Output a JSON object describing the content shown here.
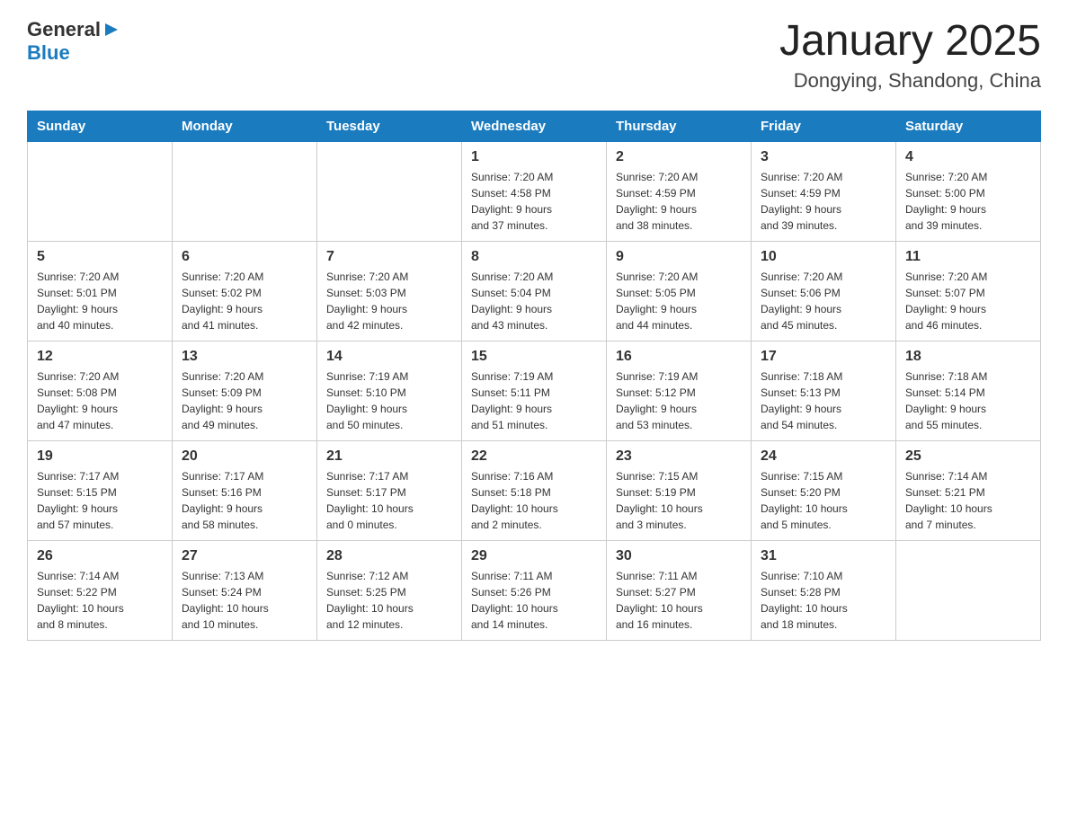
{
  "header": {
    "logo_general": "General",
    "logo_blue": "Blue",
    "month_title": "January 2025",
    "location": "Dongying, Shandong, China"
  },
  "days_of_week": [
    "Sunday",
    "Monday",
    "Tuesday",
    "Wednesday",
    "Thursday",
    "Friday",
    "Saturday"
  ],
  "weeks": [
    [
      {
        "day": "",
        "info": ""
      },
      {
        "day": "",
        "info": ""
      },
      {
        "day": "",
        "info": ""
      },
      {
        "day": "1",
        "info": "Sunrise: 7:20 AM\nSunset: 4:58 PM\nDaylight: 9 hours\nand 37 minutes."
      },
      {
        "day": "2",
        "info": "Sunrise: 7:20 AM\nSunset: 4:59 PM\nDaylight: 9 hours\nand 38 minutes."
      },
      {
        "day": "3",
        "info": "Sunrise: 7:20 AM\nSunset: 4:59 PM\nDaylight: 9 hours\nand 39 minutes."
      },
      {
        "day": "4",
        "info": "Sunrise: 7:20 AM\nSunset: 5:00 PM\nDaylight: 9 hours\nand 39 minutes."
      }
    ],
    [
      {
        "day": "5",
        "info": "Sunrise: 7:20 AM\nSunset: 5:01 PM\nDaylight: 9 hours\nand 40 minutes."
      },
      {
        "day": "6",
        "info": "Sunrise: 7:20 AM\nSunset: 5:02 PM\nDaylight: 9 hours\nand 41 minutes."
      },
      {
        "day": "7",
        "info": "Sunrise: 7:20 AM\nSunset: 5:03 PM\nDaylight: 9 hours\nand 42 minutes."
      },
      {
        "day": "8",
        "info": "Sunrise: 7:20 AM\nSunset: 5:04 PM\nDaylight: 9 hours\nand 43 minutes."
      },
      {
        "day": "9",
        "info": "Sunrise: 7:20 AM\nSunset: 5:05 PM\nDaylight: 9 hours\nand 44 minutes."
      },
      {
        "day": "10",
        "info": "Sunrise: 7:20 AM\nSunset: 5:06 PM\nDaylight: 9 hours\nand 45 minutes."
      },
      {
        "day": "11",
        "info": "Sunrise: 7:20 AM\nSunset: 5:07 PM\nDaylight: 9 hours\nand 46 minutes."
      }
    ],
    [
      {
        "day": "12",
        "info": "Sunrise: 7:20 AM\nSunset: 5:08 PM\nDaylight: 9 hours\nand 47 minutes."
      },
      {
        "day": "13",
        "info": "Sunrise: 7:20 AM\nSunset: 5:09 PM\nDaylight: 9 hours\nand 49 minutes."
      },
      {
        "day": "14",
        "info": "Sunrise: 7:19 AM\nSunset: 5:10 PM\nDaylight: 9 hours\nand 50 minutes."
      },
      {
        "day": "15",
        "info": "Sunrise: 7:19 AM\nSunset: 5:11 PM\nDaylight: 9 hours\nand 51 minutes."
      },
      {
        "day": "16",
        "info": "Sunrise: 7:19 AM\nSunset: 5:12 PM\nDaylight: 9 hours\nand 53 minutes."
      },
      {
        "day": "17",
        "info": "Sunrise: 7:18 AM\nSunset: 5:13 PM\nDaylight: 9 hours\nand 54 minutes."
      },
      {
        "day": "18",
        "info": "Sunrise: 7:18 AM\nSunset: 5:14 PM\nDaylight: 9 hours\nand 55 minutes."
      }
    ],
    [
      {
        "day": "19",
        "info": "Sunrise: 7:17 AM\nSunset: 5:15 PM\nDaylight: 9 hours\nand 57 minutes."
      },
      {
        "day": "20",
        "info": "Sunrise: 7:17 AM\nSunset: 5:16 PM\nDaylight: 9 hours\nand 58 minutes."
      },
      {
        "day": "21",
        "info": "Sunrise: 7:17 AM\nSunset: 5:17 PM\nDaylight: 10 hours\nand 0 minutes."
      },
      {
        "day": "22",
        "info": "Sunrise: 7:16 AM\nSunset: 5:18 PM\nDaylight: 10 hours\nand 2 minutes."
      },
      {
        "day": "23",
        "info": "Sunrise: 7:15 AM\nSunset: 5:19 PM\nDaylight: 10 hours\nand 3 minutes."
      },
      {
        "day": "24",
        "info": "Sunrise: 7:15 AM\nSunset: 5:20 PM\nDaylight: 10 hours\nand 5 minutes."
      },
      {
        "day": "25",
        "info": "Sunrise: 7:14 AM\nSunset: 5:21 PM\nDaylight: 10 hours\nand 7 minutes."
      }
    ],
    [
      {
        "day": "26",
        "info": "Sunrise: 7:14 AM\nSunset: 5:22 PM\nDaylight: 10 hours\nand 8 minutes."
      },
      {
        "day": "27",
        "info": "Sunrise: 7:13 AM\nSunset: 5:24 PM\nDaylight: 10 hours\nand 10 minutes."
      },
      {
        "day": "28",
        "info": "Sunrise: 7:12 AM\nSunset: 5:25 PM\nDaylight: 10 hours\nand 12 minutes."
      },
      {
        "day": "29",
        "info": "Sunrise: 7:11 AM\nSunset: 5:26 PM\nDaylight: 10 hours\nand 14 minutes."
      },
      {
        "day": "30",
        "info": "Sunrise: 7:11 AM\nSunset: 5:27 PM\nDaylight: 10 hours\nand 16 minutes."
      },
      {
        "day": "31",
        "info": "Sunrise: 7:10 AM\nSunset: 5:28 PM\nDaylight: 10 hours\nand 18 minutes."
      },
      {
        "day": "",
        "info": ""
      }
    ]
  ]
}
